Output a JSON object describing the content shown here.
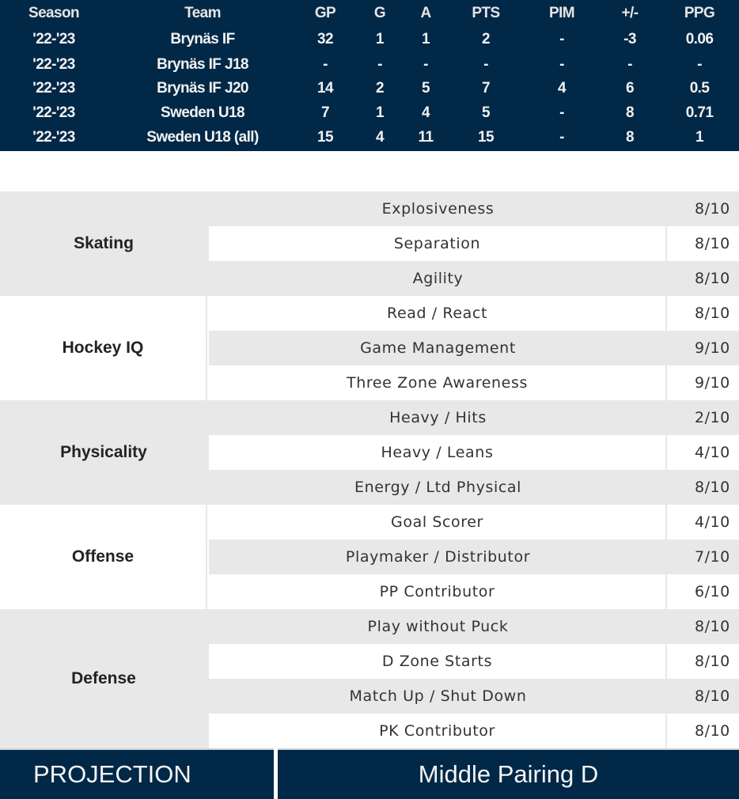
{
  "stats_table": {
    "headers": [
      "Season",
      "Team",
      "GP",
      "G",
      "A",
      "PTS",
      "PIM",
      "+/-",
      "PPG"
    ],
    "rows": [
      [
        "'22-'23",
        "Brynäs IF",
        "32",
        "1",
        "1",
        "2",
        "-",
        "-3",
        "0.06"
      ],
      [
        "'22-'23",
        "Brynäs IF J18",
        "-",
        "-",
        "-",
        "-",
        "-",
        "-",
        "-"
      ],
      [
        "'22-'23",
        "Brynäs IF J20",
        "14",
        "2",
        "5",
        "7",
        "4",
        "6",
        "0.5"
      ],
      [
        "'22-'23",
        "Sweden U18",
        "7",
        "1",
        "4",
        "5",
        "-",
        "8",
        "0.71"
      ],
      [
        "'22-'23",
        "Sweden U18 (all)",
        "15",
        "4",
        "11",
        "15",
        "-",
        "8",
        "1"
      ]
    ]
  },
  "ratings": [
    {
      "category": "Skating",
      "items": [
        {
          "label": "Explosiveness",
          "score": "8/10"
        },
        {
          "label": "Separation",
          "score": "8/10"
        },
        {
          "label": "Agility",
          "score": "8/10"
        }
      ]
    },
    {
      "category": "Hockey IQ",
      "items": [
        {
          "label": "Read / React",
          "score": "8/10"
        },
        {
          "label": "Game Management",
          "score": "9/10"
        },
        {
          "label": "Three Zone Awareness",
          "score": "9/10"
        }
      ]
    },
    {
      "category": "Physicality",
      "items": [
        {
          "label": "Heavy / Hits",
          "score": "2/10"
        },
        {
          "label": "Heavy / Leans",
          "score": "4/10"
        },
        {
          "label": "Energy / Ltd Physical",
          "score": "8/10"
        }
      ]
    },
    {
      "category": "Offense",
      "items": [
        {
          "label": "Goal Scorer",
          "score": "4/10"
        },
        {
          "label": "Playmaker / Distributor",
          "score": "7/10"
        },
        {
          "label": "PP Contributor",
          "score": "6/10"
        }
      ]
    },
    {
      "category": "Defense",
      "items": [
        {
          "label": "Play without Puck",
          "score": "8/10"
        },
        {
          "label": "D Zone Starts",
          "score": "8/10"
        },
        {
          "label": "Match Up / Shut Down",
          "score": "8/10"
        },
        {
          "label": "PK Contributor",
          "score": "8/10"
        }
      ]
    }
  ],
  "projection": {
    "label": "PROJECTION",
    "value": "Middle Pairing D"
  },
  "colors": {
    "navy": "#012847",
    "row_gray": "#e8e8e8",
    "white": "#ffffff"
  }
}
